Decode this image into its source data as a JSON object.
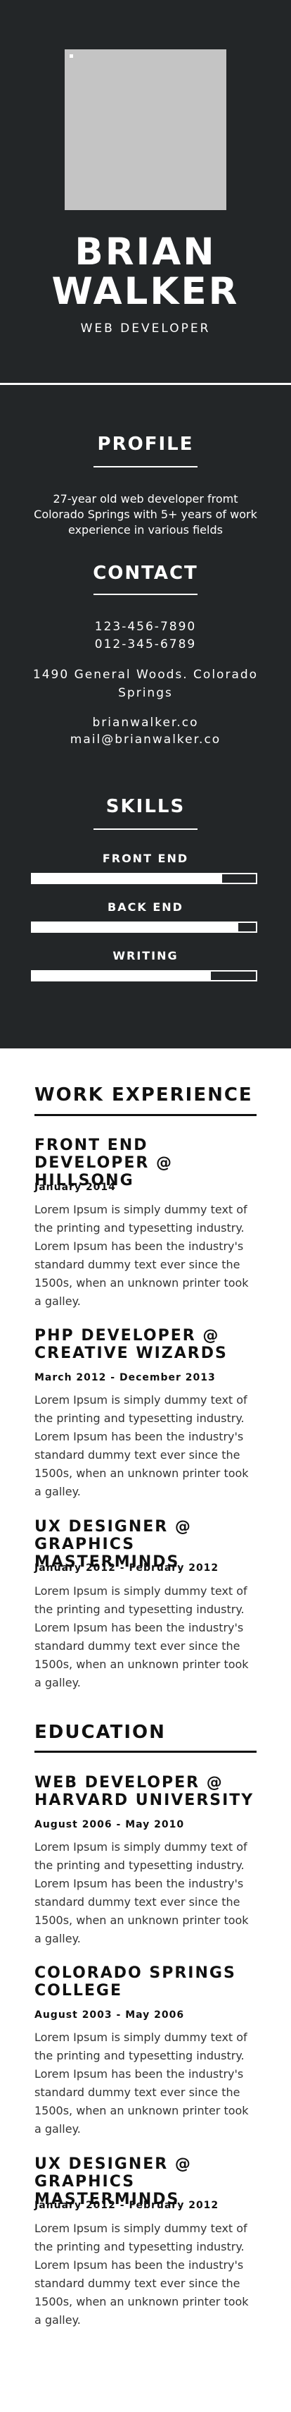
{
  "profile": {
    "first_name": "BRIAN",
    "last_name": "WALKER",
    "role": "WEB DEVELOPER"
  },
  "profile_section": {
    "title": "PROFILE",
    "text": "27-year old web developer fromt Colorado Springs with 5+ years of work experience in various fields"
  },
  "contact": {
    "title": "CONTACT",
    "phone1": "123-456-7890",
    "phone2": "012-345-6789",
    "address": "1490 General Woods. Colorado Springs",
    "website": "brianwalker.co",
    "email": "mail@brianwalker.co"
  },
  "skills": {
    "title": "SKILLS",
    "items": [
      {
        "label": "FRONT END",
        "level": 0.85
      },
      {
        "label": "BACK END",
        "level": 0.92
      },
      {
        "label": "WRITING",
        "level": 0.8
      }
    ]
  },
  "work": {
    "title": "WORK EXPERIENCE",
    "items": [
      {
        "title": "FRONT END DEVELOPER @ HILLSONG",
        "date": "January 2014",
        "desc": "Lorem Ipsum is simply dummy text of the printing and typesetting industry. Lorem Ipsum has been the industry's standard dummy text ever since the 1500s, when an unknown printer took a galley."
      },
      {
        "title": "PHP DEVELOPER @ CREATIVE WIZARDS",
        "date": "March 2012 - December 2013",
        "desc": "Lorem Ipsum is simply dummy text of the printing and typesetting industry. Lorem Ipsum has been the industry's standard dummy text ever since the 1500s, when an unknown printer took a galley."
      },
      {
        "title": "UX DESIGNER @ GRAPHICS MASTERMINDS",
        "date": "January 2012 - February 2012",
        "desc": "Lorem Ipsum is simply dummy text of the printing and typesetting industry. Lorem Ipsum has been the industry's standard dummy text ever since the 1500s, when an unknown printer took a galley."
      }
    ]
  },
  "education": {
    "title": "EDUCATION",
    "items": [
      {
        "title": "WEB DEVELOPER @ HARVARD UNIVERSITY",
        "date": "August 2006 - May 2010",
        "desc": "Lorem Ipsum is simply dummy text of the printing and typesetting industry. Lorem Ipsum has been the industry's standard dummy text ever since the 1500s, when an unknown printer took a galley."
      },
      {
        "title": "COLORADO SPRINGS COLLEGE",
        "date": "August 2003 - May 2006",
        "desc": "Lorem Ipsum is simply dummy text of the printing and typesetting industry. Lorem Ipsum has been the industry's standard dummy text ever since the 1500s, when an unknown printer took a galley."
      },
      {
        "title": "UX DESIGNER @ GRAPHICS MASTERMINDS",
        "date": "January 2012 - February 2012",
        "desc": "Lorem Ipsum is simply dummy text of the printing and typesetting industry. Lorem Ipsum has been the industry's standard dummy text ever since the 1500s, when an unknown printer took a galley."
      }
    ]
  }
}
